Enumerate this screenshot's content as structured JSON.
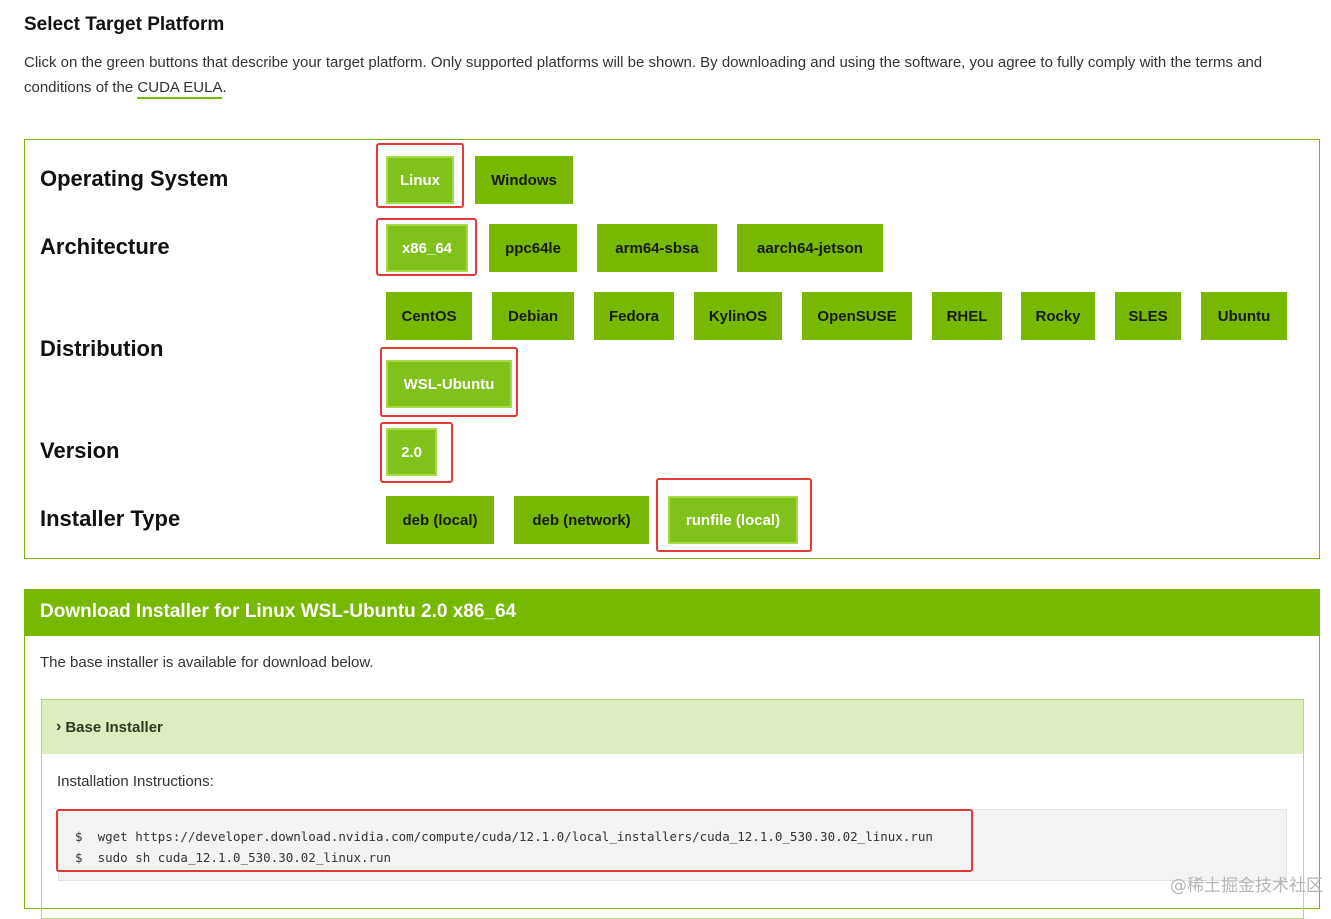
{
  "header": {
    "title": "Select Target Platform",
    "intro": "Click on the green buttons that describe your target platform. Only supported platforms will be shown. By downloading and using the software, you agree to fully comply with the terms and conditions of the",
    "eula_link": "CUDA EULA",
    "intro_end": "."
  },
  "selector": {
    "os": {
      "label": "Operating System",
      "options": [
        "Linux",
        "Windows"
      ],
      "selected": "Linux"
    },
    "arch": {
      "label": "Architecture",
      "options": [
        "x86_64",
        "ppc64le",
        "arm64-sbsa",
        "aarch64-jetson"
      ],
      "selected": "x86_64"
    },
    "distro": {
      "label": "Distribution",
      "options": [
        "CentOS",
        "Debian",
        "Fedora",
        "KylinOS",
        "OpenSUSE",
        "RHEL",
        "Rocky",
        "SLES",
        "Ubuntu",
        "WSL-Ubuntu"
      ],
      "selected": "WSL-Ubuntu"
    },
    "version": {
      "label": "Version",
      "options": [
        "2.0"
      ],
      "selected": "2.0"
    },
    "installer": {
      "label": "Installer Type",
      "options": [
        "deb (local)",
        "deb (network)",
        "runfile (local)"
      ],
      "selected": "runfile (local)"
    }
  },
  "download": {
    "title": "Download Installer for Linux WSL-Ubuntu 2.0 x86_64",
    "note": "The base installer is available for download below.",
    "base_installer": {
      "label": "Base Installer",
      "instructions_label": "Installation Instructions:",
      "commands": [
        "$  wget https://developer.download.nvidia.com/compute/cuda/12.1.0/local_installers/cuda_12.1.0_530.30.02_linux.run",
        "$  sudo sh cuda_12.1.0_530.30.02_linux.run"
      ]
    }
  },
  "watermark": "@稀土掘金技术社区",
  "colors": {
    "accent": "#76b900",
    "highlight": "#e53935"
  },
  "icons": {
    "expand": "chevron-right-icon"
  }
}
